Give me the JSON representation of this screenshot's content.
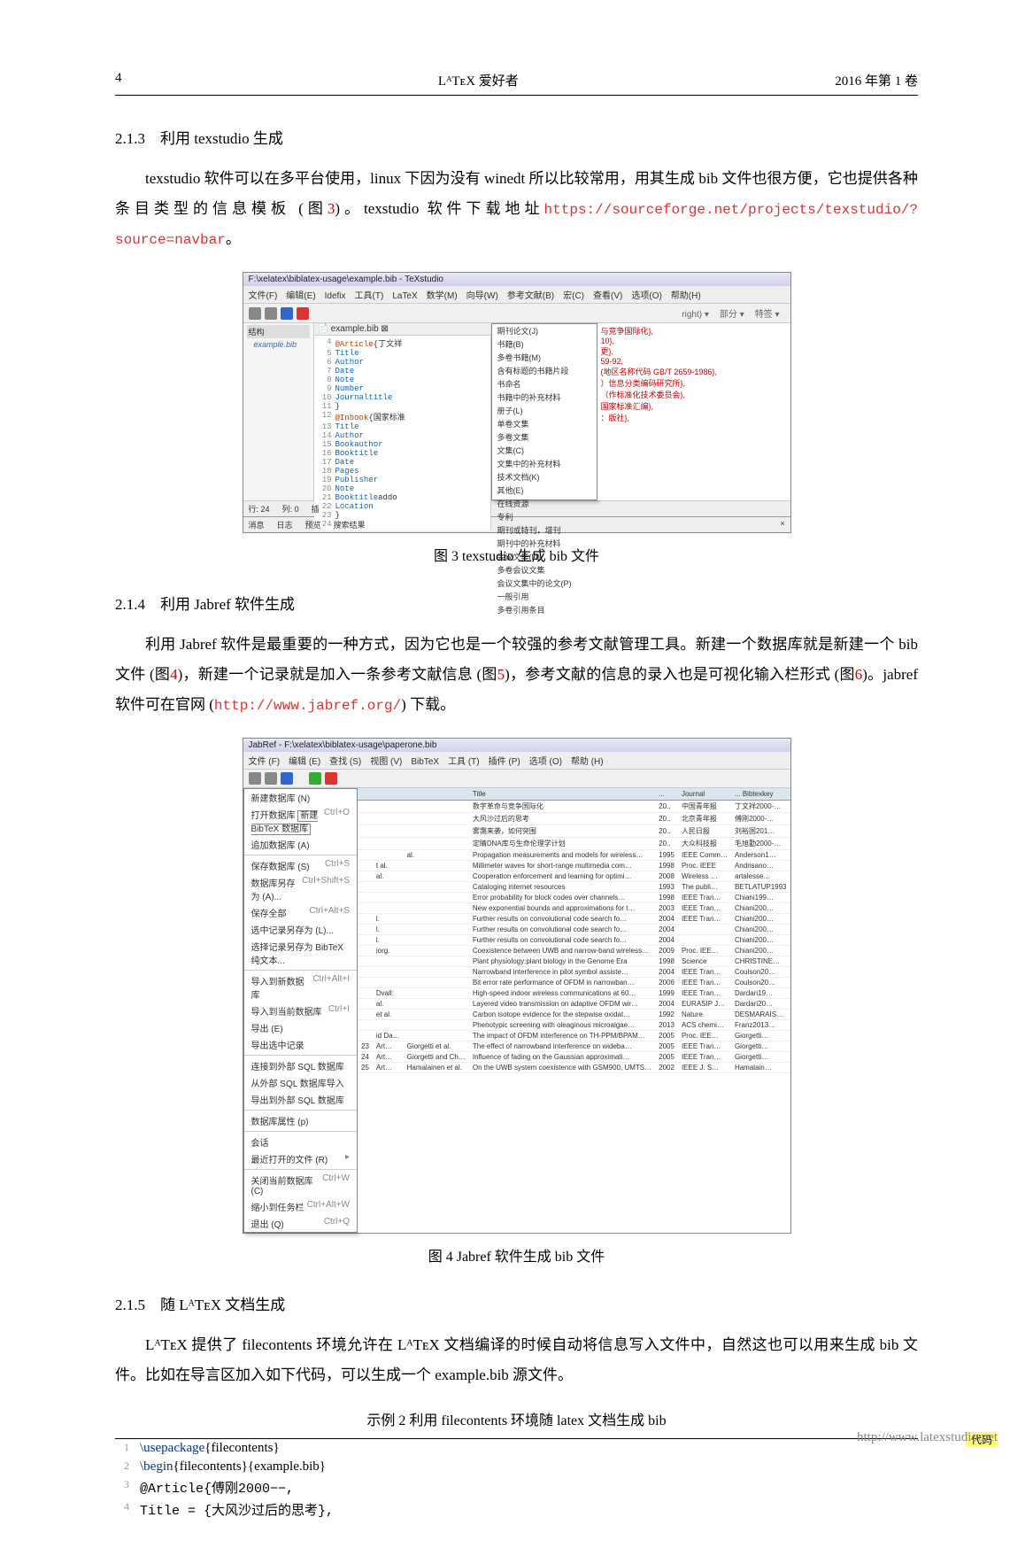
{
  "header": {
    "pageno": "4",
    "center": "LᴬTᴇX 爱好者",
    "right": "2016 年第 1 卷"
  },
  "sec213": {
    "title": "2.1.3　利用 texstudio 生成",
    "body": "texstudio 软件可以在多平台使用，linux 下因为没有 winedt 所以比较常用，用其生成 bib 文件也很方便，它也提供各种条目类型的信息模板 (图",
    "figref": "3",
    "body2": ")。texstudio 软件下载地址",
    "link": "https://sourceforge.net/projects/texstudio/?source=navbar",
    "body3": "。"
  },
  "fig3": {
    "title": "F:\\xelatex\\biblatex-usage\\example.bib - TeXstudio",
    "menus": [
      "文件(F)",
      "编辑(E)",
      "Idefix",
      "工具(T)",
      "LaTeX",
      "数学(M)",
      "向导(W)",
      "参考文献(B)",
      "宏(C)",
      "查看(V)",
      "选项(O)",
      "帮助(H)"
    ],
    "sidebar_label": "结构",
    "sidebar_file": "example.bib",
    "tab": "example.bib",
    "lines": [
      {
        "n": "4",
        "t": "@Article{丁文祥"
      },
      {
        "n": "5",
        "t": "  Title"
      },
      {
        "n": "6",
        "t": "  Author"
      },
      {
        "n": "7",
        "t": "  Date"
      },
      {
        "n": "8",
        "t": "  Note"
      },
      {
        "n": "9",
        "t": "  Number"
      },
      {
        "n": "10",
        "t": "  Journaltitle"
      },
      {
        "n": "11",
        "t": "}"
      },
      {
        "n": "12",
        "t": "@Inbook{国家标准"
      },
      {
        "n": "13",
        "t": "  Title"
      },
      {
        "n": "14",
        "t": "  Author"
      },
      {
        "n": "15",
        "t": "  Bookauthor"
      },
      {
        "n": "16",
        "t": "  Booktitle"
      },
      {
        "n": "17",
        "t": "  Date"
      },
      {
        "n": "18",
        "t": "  Pages"
      },
      {
        "n": "19",
        "t": "  Publisher"
      },
      {
        "n": "20",
        "t": "  Note"
      },
      {
        "n": "21",
        "t": "  Booktitleaddo"
      },
      {
        "n": "22",
        "t": "  Location"
      },
      {
        "n": "23",
        "t": "}"
      },
      {
        "n": "24",
        "t": ""
      }
    ],
    "dropdown": [
      "期刊论文(J)",
      "书籍(B)",
      "多卷书籍(M)",
      "含有标题的书籍片段",
      "书命名",
      "书籍中的补充材料",
      "册子(L)",
      "单卷文集",
      "多卷文集",
      "文集(C)",
      "文集中的补充材料",
      "技术文档(K)",
      "其他(E)",
      "在线资源",
      "专利",
      "期刊或特刊，增刊",
      "期刊中的补充材料",
      "会议文集(D)",
      "多卷会议文集",
      "会议文集中的论文(P)",
      "一般引用",
      "多卷引用条目"
    ],
    "rightpane": [
      "与竞争国际化},",
      "10},",
      "",
      "更},",
      "59-92,",
      "(地区名称代码 GB/T 2659-1986},",
      "）信息分类编码研究所},",
      "（作标准化技术委员会},",
      "国家标准汇编},",
      "",
      "：版社},",
      ""
    ],
    "status": {
      "row": "行: 24",
      "col": "列: 0",
      "ins": "插",
      "tabs": [
        "消息",
        "日志",
        "预览",
        "搜索结果"
      ]
    },
    "toolbar_right": [
      "right)",
      "部分",
      "特签"
    ],
    "caption": "图 3 texstudio 生成 bib 文件"
  },
  "sec214": {
    "title": "2.1.4　利用 Jabref 软件生成",
    "body": "利用 Jabref 软件是最重要的一种方式，因为它也是一个较强的参考文献管理工具。新建一个数据库就是新建一个 bib 文件 (图",
    "figref1": "4",
    "body2": ")，新建一个记录就是加入一条参考文献信息 (图",
    "figref2": "5",
    "body3": ")，参考文献的信息的录入也是可视化输入栏形式 (图",
    "figref3": "6",
    "body4": ")。jabref 软件可在官网 (",
    "link": "http://www.jabref.org/",
    "body5": ") 下载。"
  },
  "fig4": {
    "title": "JabRef - F:\\xelatex\\biblatex-usage\\paperone.bib",
    "menus": [
      "文件 (F)",
      "编辑 (E)",
      "查找 (S)",
      "视图 (V)",
      "BibTeX",
      "工具 (T)",
      "插件 (P)",
      "选项 (O)",
      "帮助 (H)"
    ],
    "menuitems": [
      {
        "l": "新建数据库 (N)",
        "s": ""
      },
      {
        "l": "打开数据库",
        "s": "Ctrl+O",
        "boxed": "新建 BibTeX 数据库"
      },
      {
        "l": "追加数据库 (A)",
        "s": ""
      },
      {
        "l": "保存数据库 (S)",
        "s": "Ctrl+S"
      },
      {
        "l": "数据库另存为 (A)...",
        "s": "Ctrl+Shift+S"
      },
      {
        "l": "保存全部",
        "s": "Ctrl+Alt+S"
      },
      {
        "l": "选中记录另存为 (L)...",
        "s": ""
      },
      {
        "l": "选择记录另存为 BibTeX 纯文本...",
        "s": ""
      },
      {
        "l": "导入到新数据库",
        "s": "Ctrl+Alt+I"
      },
      {
        "l": "导入到当前数据库",
        "s": "Ctrl+I"
      },
      {
        "l": "导出 (E)",
        "s": ""
      },
      {
        "l": "导出选中记录",
        "s": ""
      },
      {
        "l": "连接到外部 SQL 数据库",
        "s": ""
      },
      {
        "l": "从外部 SQL 数据库导入",
        "s": ""
      },
      {
        "l": "导出到外部 SQL 数据库",
        "s": ""
      },
      {
        "l": "数据库属性 (p)",
        "s": ""
      },
      {
        "l": "会话",
        "s": ""
      },
      {
        "l": "最近打开的文件 (R)",
        "s": "▸"
      },
      {
        "l": "关闭当前数据库 (C)",
        "s": "Ctrl+W"
      },
      {
        "l": "缩小到任务栏",
        "s": "Ctrl+Alt+W"
      },
      {
        "l": "退出 (Q)",
        "s": "Ctrl+Q"
      }
    ],
    "table_headers": [
      "",
      "",
      "",
      "Title",
      "...",
      "Journal",
      "... Bibtexkey"
    ],
    "rows": [
      [
        "",
        "",
        "",
        "数字革命与竞争国际化",
        "20..",
        "中国青年报",
        "丁文祥2000-…"
      ],
      [
        "",
        "",
        "",
        "大风沙过后的思考",
        "20..",
        "北京青年报",
        "傅刚2000-…"
      ],
      [
        "",
        "",
        "",
        "雾霭来袭，如何突围",
        "20..",
        "人民日报",
        "刘裕国201…"
      ],
      [
        "",
        "",
        "",
        "定睛DNA库与生命伦理学计划",
        "20..",
        "大众科技报",
        "毛旭勤2000-…"
      ],
      [
        "",
        "",
        "al.",
        "Propagation measurements and models for wireless…",
        "1995",
        "IEEE Comm…",
        "Anderson1…"
      ],
      [
        "",
        "t al.",
        "",
        "Millimeter waves for short-range multimedia com…",
        "1998",
        "Proc. IEEE",
        "Andrisano…"
      ],
      [
        "",
        "al.",
        "",
        "Cooperation enforcement and learning for optimi…",
        "2008",
        "Wireless …",
        "artalesse…"
      ],
      [
        "",
        "",
        "",
        "Cataloging internet resources",
        "1993",
        "The publi…",
        "BETLATUP1993"
      ],
      [
        "",
        "",
        "",
        "Error probability for block codes over channels…",
        "1998",
        "IEEE Tran…",
        "Chiani199…"
      ],
      [
        "",
        "",
        "",
        "New exponential bounds and approximations for t…",
        "2003",
        "IEEE Tran…",
        "Chiani200…"
      ],
      [
        "",
        "l.",
        "",
        "Further results on convolutional code search fo…",
        "2004",
        "IEEE Tran…",
        "Chiani200…"
      ],
      [
        "",
        "l.",
        "",
        "Further results on convolutional code search fo…",
        "2004",
        "",
        "Chiani200…"
      ],
      [
        "",
        "l.",
        "",
        "Further results on convolutional code search fo…",
        "2004",
        "",
        "Chiani200…"
      ],
      [
        "",
        "iorg.",
        "",
        "Coexistence between UWB and narrow-band wireless…",
        "2009",
        "Proc. IEE…",
        "Chiani200…"
      ],
      [
        "",
        "",
        "",
        "Plant physiology:plant biology in the Genome Era",
        "1998",
        "Science",
        "CHRISTINE…"
      ],
      [
        "",
        "",
        "",
        "Narrowband interference in pilot symbol assiste…",
        "2004",
        "IEEE Tran…",
        "Coulson20…"
      ],
      [
        "",
        "",
        "",
        "Bit error rate performance of OFDM in narrowban…",
        "2006",
        "IEEE Tran…",
        "Coulson20…"
      ],
      [
        "",
        "Dvall:",
        "",
        "High-speed indoor wireless communications at 60…",
        "1999",
        "IEEE Tran…",
        "Dardari19…"
      ],
      [
        "",
        "al.",
        "",
        "Layered video transmission on adaptive OFDM wir…",
        "2004",
        "EURASIP J…",
        "Dardari20…"
      ],
      [
        "",
        "et al.",
        "",
        "Carbon isotope evidence for the stepwise oxidat…",
        "1992",
        "Nature",
        "DESMARAIS…"
      ],
      [
        "",
        "",
        "",
        "Phenotypic screening with oleaginous microalgae…",
        "2013",
        "ACS chemi…",
        "Franz2013…"
      ],
      [
        "",
        "id Da…",
        "",
        "The impact of OFDM interference on TH-PPM/BPAM…",
        "2005",
        "Proc. IEE…",
        "Giorgetti…"
      ],
      [
        "23",
        "Art…",
        "Giorgetti et al.",
        "The effect of narrowband interference on wideba…",
        "2005",
        "IEEE Tran…",
        "Giorgetti…"
      ],
      [
        "24",
        "Art…",
        "Giorgetti and Ch…",
        "Influence of fading on the Gaussian approximati…",
        "2005",
        "IEEE Tran…",
        "Giorgetti…"
      ],
      [
        "25",
        "Art…",
        "Hamalainen et al.",
        "On the UWB system coexistence with GSM900, UMTS…",
        "2002",
        "IEEE J. S…",
        "Hamalain…"
      ]
    ],
    "caption": "图 4 Jabref 软件生成 bib 文件"
  },
  "sec215": {
    "title": "2.1.5　随 LᴬTᴇX 文档生成",
    "body": "LᴬTᴇX 提供了 filecontents 环境允许在 LᴬTᴇX 文档编译的时候自动将信息写入文件中，自然这也可以用来生成 bib 文件。比如在导言区加入如下代码，可以生成一个 example.bib 源文件。"
  },
  "example": {
    "title": "示例 2 利用 filecontents 环境随 latex 文档生成 bib",
    "label": "代码",
    "lines": [
      {
        "n": "1",
        "cmd": "\\usepackage",
        "arg": "{filecontents}"
      },
      {
        "n": "2",
        "cmd": "\\begin",
        "arg": "{filecontents}{example.bib}"
      },
      {
        "n": "3",
        "plain": "@Article{傅刚2000−−,"
      },
      {
        "n": "4",
        "plain": "   Title = {大风沙过后的思考},"
      }
    ]
  },
  "footer": "http://www.latexstudio.net"
}
